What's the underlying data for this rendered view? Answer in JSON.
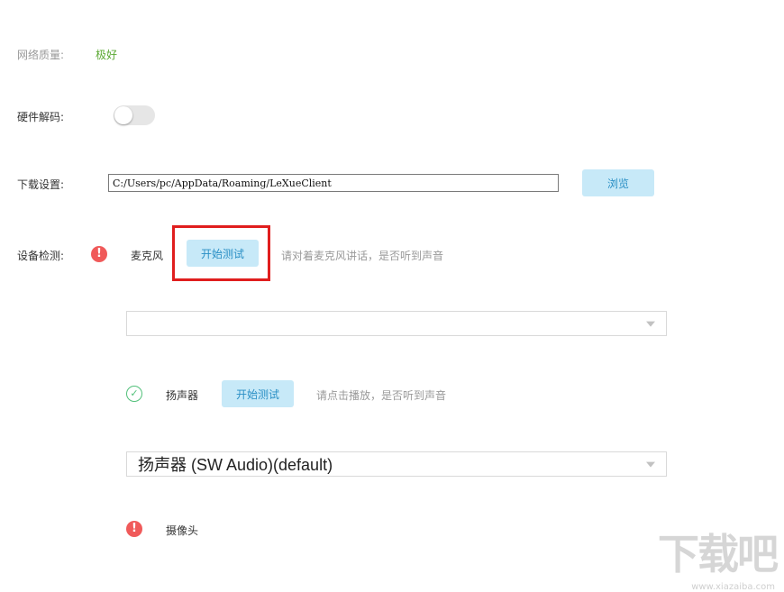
{
  "network": {
    "label": "网络质量:",
    "value": "极好"
  },
  "hardware_decode": {
    "label": "硬件解码:",
    "enabled": false
  },
  "download": {
    "label": "下载设置:",
    "path": "C:/Users/pc/AppData/Roaming/LeXueClient",
    "browse_label": "浏览"
  },
  "device_check": {
    "label": "设备检测:",
    "microphone": {
      "status": "error",
      "status_icon": "exclamation-icon",
      "name": "麦克风",
      "test_label": "开始测试",
      "hint": "请对着麦克风讲话，是否听到声音",
      "selected": ""
    },
    "speaker": {
      "status": "ok",
      "status_icon": "check-circle-icon",
      "name": "扬声器",
      "test_label": "开始测试",
      "hint": "请点击播放，是否听到声音",
      "selected": "扬声器 (SW Audio)(default)"
    },
    "camera": {
      "status": "error",
      "status_icon": "exclamation-icon",
      "name": "摄像头"
    }
  },
  "colors": {
    "good": "#5aa832",
    "error": "#f05a5a",
    "ok": "#52c07a",
    "button_bg": "#c7e9f8",
    "button_text": "#2a8fc5",
    "highlight": "#e01e1e"
  },
  "watermark": {
    "text": "下载吧",
    "sub": "www.xiazaiba.com"
  }
}
